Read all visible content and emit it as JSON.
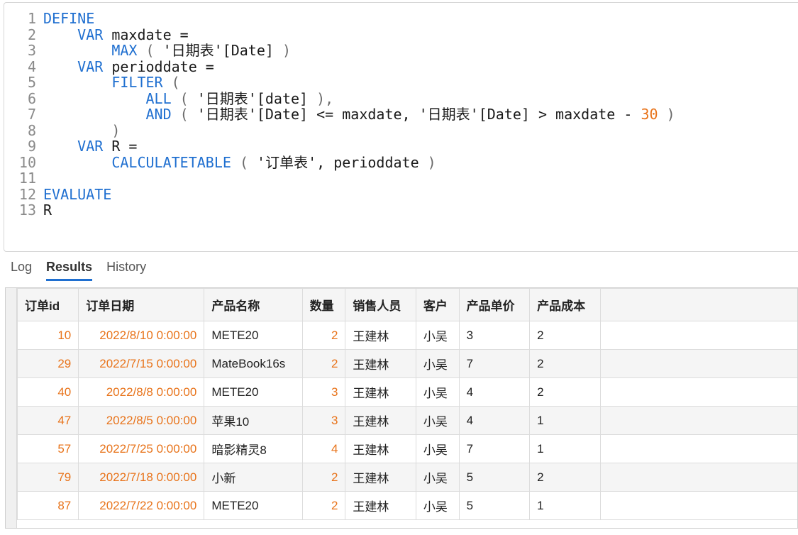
{
  "editor": {
    "lines": [
      {
        "n": "1",
        "tokens": [
          {
            "t": "DEFINE",
            "c": "kw"
          }
        ]
      },
      {
        "n": "2",
        "tokens": [
          {
            "t": "    ",
            "c": "ident"
          },
          {
            "t": "VAR",
            "c": "kw"
          },
          {
            "t": " maxdate =",
            "c": "ident"
          }
        ]
      },
      {
        "n": "3",
        "tokens": [
          {
            "t": "        ",
            "c": "ident"
          },
          {
            "t": "MAX",
            "c": "fn"
          },
          {
            "t": " ( ",
            "c": "br"
          },
          {
            "t": "'日期表'[Date]",
            "c": "str"
          },
          {
            "t": " )",
            "c": "br"
          }
        ]
      },
      {
        "n": "4",
        "tokens": [
          {
            "t": "    ",
            "c": "ident"
          },
          {
            "t": "VAR",
            "c": "kw"
          },
          {
            "t": " perioddate =",
            "c": "ident"
          }
        ]
      },
      {
        "n": "5",
        "tokens": [
          {
            "t": "        ",
            "c": "ident"
          },
          {
            "t": "FILTER",
            "c": "fn"
          },
          {
            "t": " (",
            "c": "br"
          }
        ]
      },
      {
        "n": "6",
        "tokens": [
          {
            "t": "            ",
            "c": "ident"
          },
          {
            "t": "ALL",
            "c": "fn"
          },
          {
            "t": " ( ",
            "c": "br"
          },
          {
            "t": "'日期表'[date]",
            "c": "str"
          },
          {
            "t": " ),",
            "c": "br"
          }
        ]
      },
      {
        "n": "7",
        "tokens": [
          {
            "t": "            ",
            "c": "ident"
          },
          {
            "t": "AND",
            "c": "fn"
          },
          {
            "t": " ( ",
            "c": "br"
          },
          {
            "t": "'日期表'[Date] <= maxdate, '日期表'[Date] > maxdate - ",
            "c": "str"
          },
          {
            "t": "30",
            "c": "num"
          },
          {
            "t": " )",
            "c": "br"
          }
        ]
      },
      {
        "n": "8",
        "tokens": [
          {
            "t": "        )",
            "c": "br"
          }
        ]
      },
      {
        "n": "9",
        "tokens": [
          {
            "t": "    ",
            "c": "ident"
          },
          {
            "t": "VAR",
            "c": "kw"
          },
          {
            "t": " R =",
            "c": "ident"
          }
        ]
      },
      {
        "n": "10",
        "tokens": [
          {
            "t": "        ",
            "c": "ident"
          },
          {
            "t": "CALCULATETABLE",
            "c": "fn"
          },
          {
            "t": " ( ",
            "c": "br"
          },
          {
            "t": "'订单表', perioddate",
            "c": "str"
          },
          {
            "t": " )",
            "c": "br"
          }
        ]
      },
      {
        "n": "11",
        "tokens": []
      },
      {
        "n": "12",
        "tokens": [
          {
            "t": "EVALUATE",
            "c": "kw"
          }
        ]
      },
      {
        "n": "13",
        "tokens": [
          {
            "t": "R",
            "c": "ident"
          }
        ]
      }
    ]
  },
  "tabs": [
    {
      "label": "Log",
      "active": false
    },
    {
      "label": "Results",
      "active": true
    },
    {
      "label": "History",
      "active": false
    }
  ],
  "results": {
    "columns": [
      "订单id",
      "订单日期",
      "产品名称",
      "数量",
      "销售人员",
      "客户",
      "产品单价",
      "产品成本"
    ],
    "rows": [
      [
        "10",
        "2022/8/10 0:00:00",
        "METE20",
        "2",
        "王建林",
        "小吴",
        "3",
        "2"
      ],
      [
        "29",
        "2022/7/15 0:00:00",
        "MateBook16s",
        "2",
        "王建林",
        "小吴",
        "7",
        "2"
      ],
      [
        "40",
        "2022/8/8 0:00:00",
        "METE20",
        "3",
        "王建林",
        "小吴",
        "4",
        "2"
      ],
      [
        "47",
        "2022/8/5 0:00:00",
        "苹果10",
        "3",
        "王建林",
        "小吴",
        "4",
        "1"
      ],
      [
        "57",
        "2022/7/25 0:00:00",
        "暗影精灵8",
        "4",
        "王建林",
        "小吴",
        "7",
        "1"
      ],
      [
        "79",
        "2022/7/18 0:00:00",
        "小新",
        "2",
        "王建林",
        "小吴",
        "5",
        "2"
      ],
      [
        "87",
        "2022/7/22 0:00:00",
        "METE20",
        "2",
        "王建林",
        "小吴",
        "5",
        "1"
      ]
    ]
  },
  "colors": {
    "keyword": "#1f6fd0",
    "number": "#e8731a",
    "tab_underline": "#1f6fd0"
  }
}
